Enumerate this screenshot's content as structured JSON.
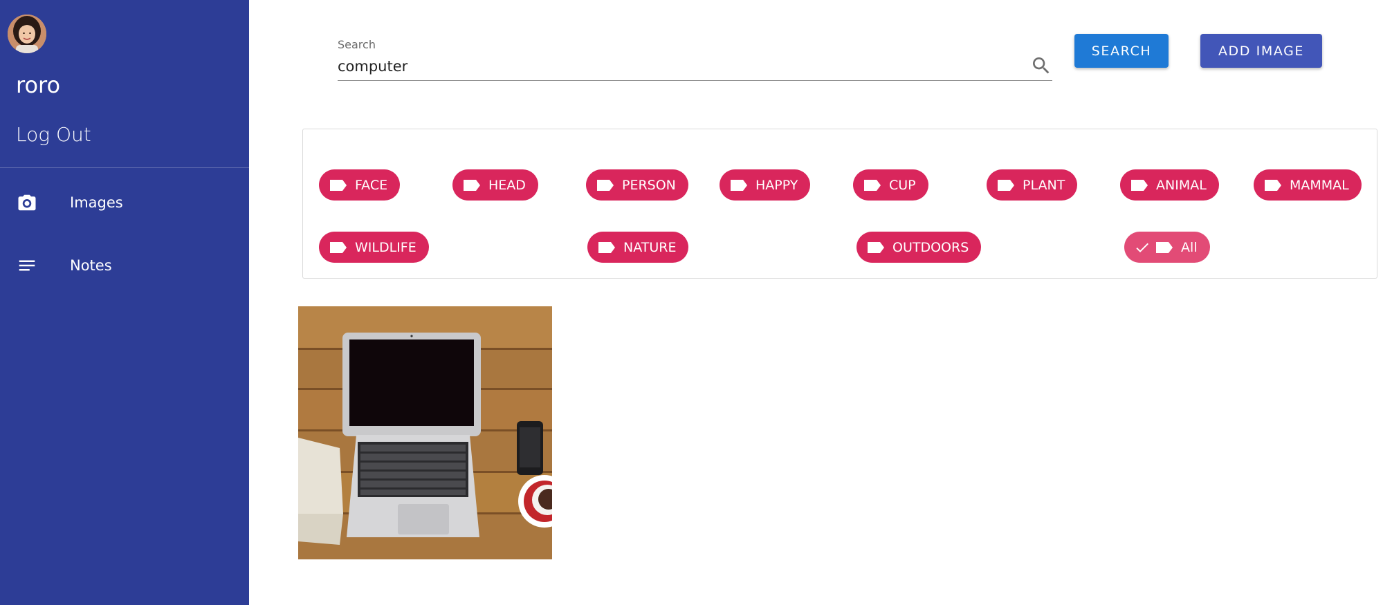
{
  "sidebar": {
    "username": "roro",
    "logout_label": "Log Out",
    "nav": [
      {
        "label": "Images",
        "icon": "camera-icon"
      },
      {
        "label": "Notes",
        "icon": "notes-icon"
      }
    ]
  },
  "search": {
    "label": "Search",
    "value": "computer",
    "icon": "search-icon"
  },
  "buttons": {
    "search_label": "SEARCH",
    "add_image_label": "ADD IMAGE"
  },
  "tags": [
    {
      "label": "FACE",
      "selected": false
    },
    {
      "label": "HEAD",
      "selected": false
    },
    {
      "label": "PERSON",
      "selected": false
    },
    {
      "label": "HAPPY",
      "selected": false
    },
    {
      "label": "CUP",
      "selected": false
    },
    {
      "label": "PLANT",
      "selected": false
    },
    {
      "label": "ANIMAL",
      "selected": false
    },
    {
      "label": "MAMMAL",
      "selected": false
    },
    {
      "label": "WILDLIFE",
      "selected": false
    },
    {
      "label": "NATURE",
      "selected": false
    },
    {
      "label": "OUTDOORS",
      "selected": false
    },
    {
      "label": "All",
      "selected": true
    }
  ],
  "colors": {
    "sidebar": "#2d3d96",
    "chip": "#d9265c",
    "chip_selected": "#e24b76",
    "search_button": "#1f7ad6",
    "add_button": "#4256b8"
  }
}
